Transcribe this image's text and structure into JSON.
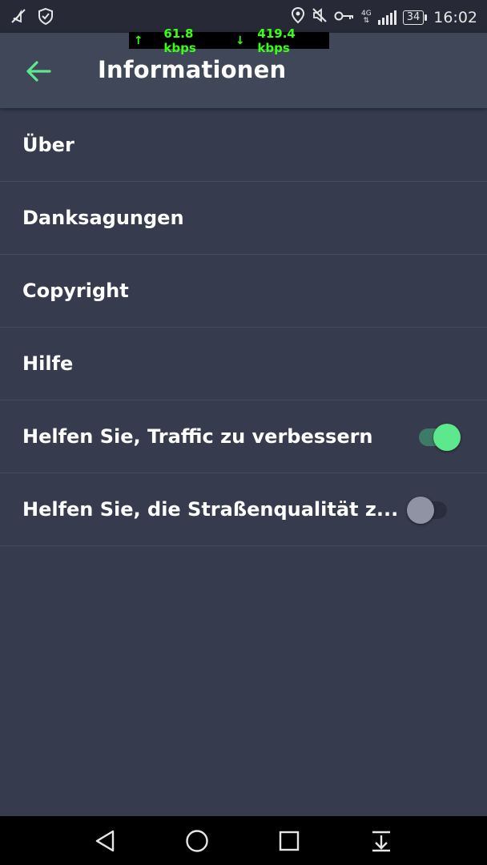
{
  "status_bar": {
    "time": "16:02",
    "battery": "34",
    "network": "4G",
    "icons": [
      "mute-icon",
      "shield-check-icon",
      "location-icon",
      "vibrate-off-icon",
      "vpn-key-icon",
      "signal-icon",
      "battery-icon"
    ]
  },
  "speed_meter": {
    "upload": "61.8 kbps",
    "download": "419.4 kbps"
  },
  "app_bar": {
    "title": "Informationen",
    "back_icon": "arrow-back-icon"
  },
  "items": [
    {
      "label": "Über"
    },
    {
      "label": "Danksagungen"
    },
    {
      "label": "Copyright"
    },
    {
      "label": "Hilfe"
    },
    {
      "label": "Helfen Sie, Traffic zu verbessern",
      "toggle": true,
      "on": true
    },
    {
      "label": "Helfen Sie, die Straßenqualität z...",
      "toggle": true,
      "on": false
    }
  ],
  "colors": {
    "background": "#363b4d",
    "app_bar": "#404759",
    "accent": "#5ee88e",
    "status_bar": "#272a36"
  },
  "nav_bar": {
    "buttons": [
      "back-triangle-icon",
      "home-circle-icon",
      "recents-square-icon",
      "notification-pull-icon"
    ]
  }
}
